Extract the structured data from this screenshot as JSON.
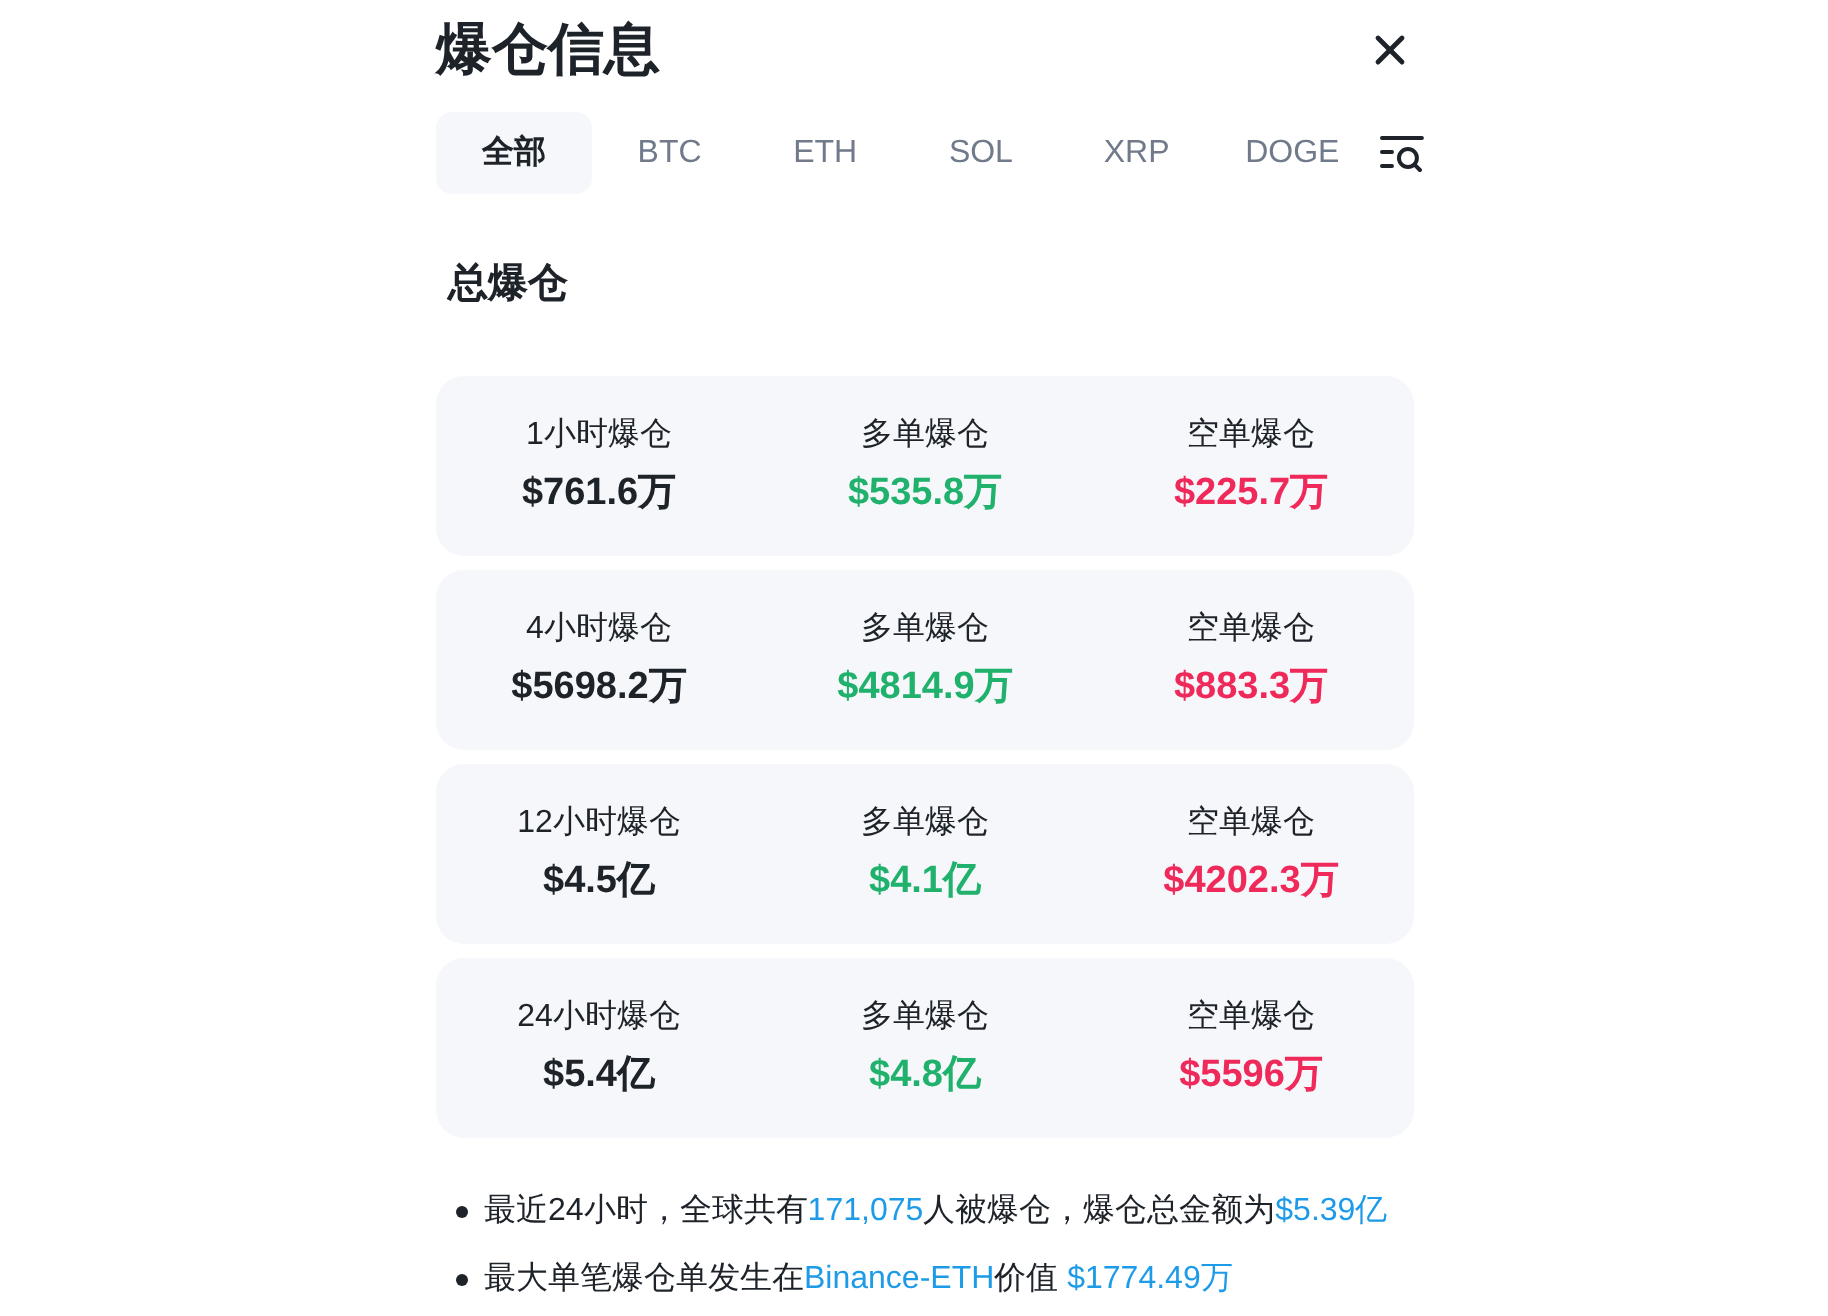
{
  "header": {
    "title": "爆仓信息"
  },
  "tabs": [
    {
      "label": "全部",
      "selected": true
    },
    {
      "label": "BTC",
      "selected": false
    },
    {
      "label": "ETH",
      "selected": false
    },
    {
      "label": "SOL",
      "selected": false
    },
    {
      "label": "XRP",
      "selected": false
    },
    {
      "label": "DOGE",
      "selected": false
    }
  ],
  "section_title": "总爆仓",
  "cards": [
    {
      "cells": [
        {
          "kind": "total",
          "label": "1小时爆仓",
          "value": "$761.6万"
        },
        {
          "kind": "long",
          "label": "多单爆仓",
          "value": "$535.8万"
        },
        {
          "kind": "short",
          "label": "空单爆仓",
          "value": "$225.7万"
        }
      ]
    },
    {
      "cells": [
        {
          "kind": "total",
          "label": "4小时爆仓",
          "value": "$5698.2万"
        },
        {
          "kind": "long",
          "label": "多单爆仓",
          "value": "$4814.9万"
        },
        {
          "kind": "short",
          "label": "空单爆仓",
          "value": "$883.3万"
        }
      ]
    },
    {
      "cells": [
        {
          "kind": "total",
          "label": "12小时爆仓",
          "value": "$4.5亿"
        },
        {
          "kind": "long",
          "label": "多单爆仓",
          "value": "$4.1亿"
        },
        {
          "kind": "short",
          "label": "空单爆仓",
          "value": "$4202.3万"
        }
      ]
    },
    {
      "cells": [
        {
          "kind": "total",
          "label": "24小时爆仓",
          "value": "$5.4亿"
        },
        {
          "kind": "long",
          "label": "多单爆仓",
          "value": "$4.8亿"
        },
        {
          "kind": "short",
          "label": "空单爆仓",
          "value": "$5596万"
        }
      ]
    }
  ],
  "notes": [
    {
      "segments": [
        {
          "kind": "plain",
          "text": "最近24小时，全球共有"
        },
        {
          "kind": "highlight",
          "text": "171,075"
        },
        {
          "kind": "plain",
          "text": "人被爆仓，爆仓总金额为"
        },
        {
          "kind": "highlight",
          "text": "$5.39亿"
        }
      ]
    },
    {
      "segments": [
        {
          "kind": "plain",
          "text": "最大单笔爆仓单发生在"
        },
        {
          "kind": "highlight",
          "text": "Binance-ETH"
        },
        {
          "kind": "plain",
          "text": "价值 "
        },
        {
          "kind": "highlight",
          "text": "$1774.49万"
        }
      ]
    }
  ]
}
